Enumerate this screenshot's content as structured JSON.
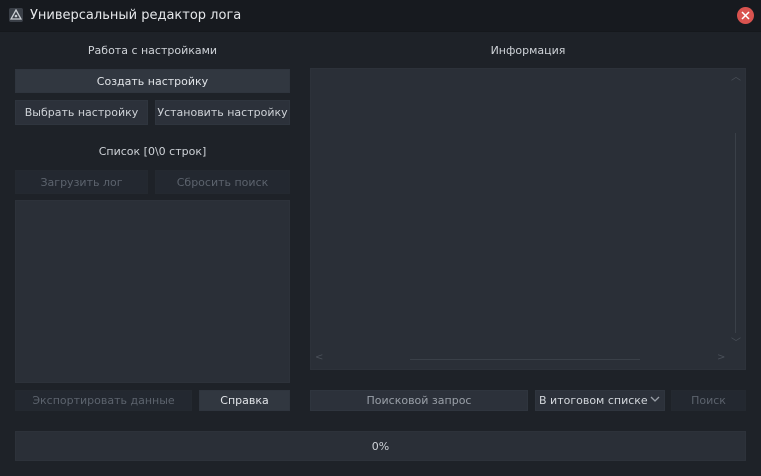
{
  "window": {
    "title": "Универсальный редактор лога",
    "app_icon": "app-logo-icon",
    "close_icon": "close-icon"
  },
  "settings": {
    "title": "Работа с настройками",
    "create_label": "Создать настройку",
    "choose_label": "Выбрать настройку",
    "install_label": "Установить настройку"
  },
  "list": {
    "title": "Список [0\\0 строк]",
    "load_log_label": "Загрузить лог",
    "reset_search_label": "Сбросить поиск",
    "items": []
  },
  "bottom_left": {
    "export_label": "Экспортировать данные",
    "help_label": "Справка"
  },
  "info": {
    "title": "Информация",
    "content": ""
  },
  "search": {
    "placeholder": "Поисковой запрос",
    "value": "",
    "scope_selected": "В итоговом списке",
    "search_label": "Поиск"
  },
  "progress": {
    "label": "0%",
    "value": 0
  },
  "colors": {
    "background": "#1e2228",
    "panel": "#2a2f37",
    "close": "#d9534f"
  }
}
